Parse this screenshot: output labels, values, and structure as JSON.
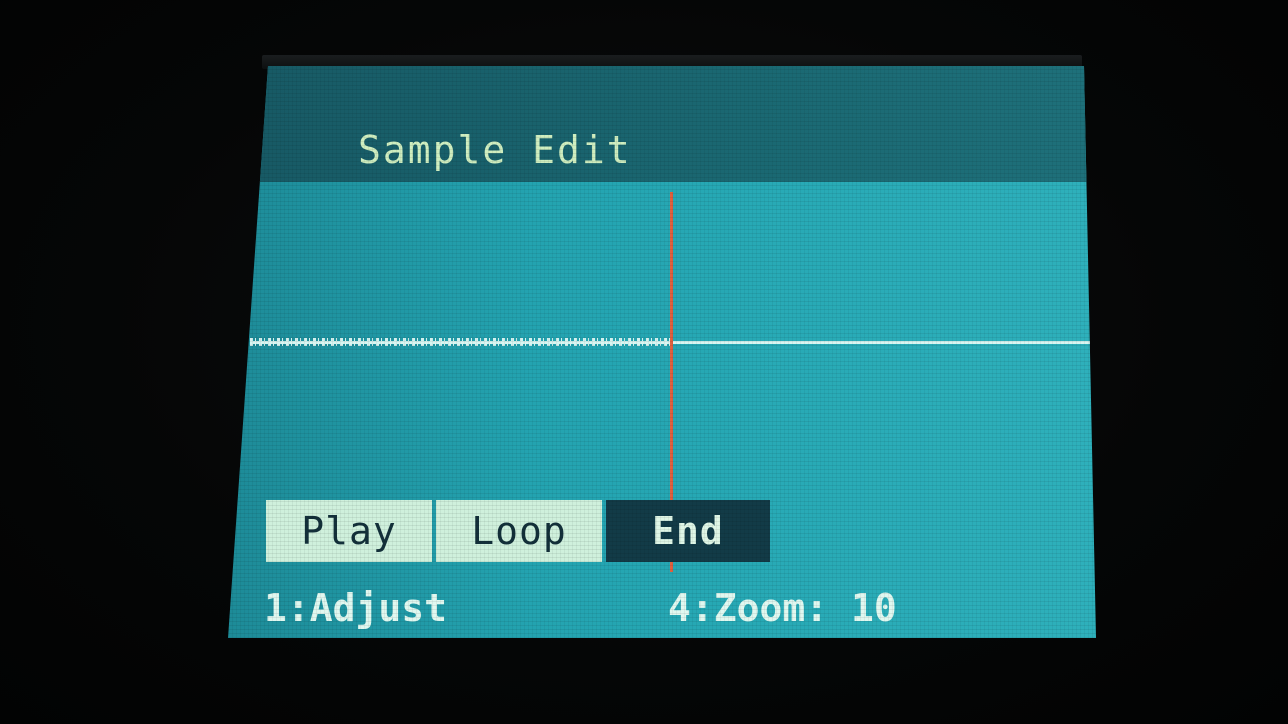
{
  "screen": {
    "title": "Sample Edit",
    "modes": [
      {
        "label": "Play",
        "selected": false
      },
      {
        "label": "Loop",
        "selected": false
      },
      {
        "label": "End",
        "selected": true
      }
    ],
    "knob_hints": {
      "knob1": "1:Adjust",
      "knob4": "4:Zoom: 10"
    },
    "zoom_level": 10
  },
  "colors": {
    "screen_background": "#27a9b5",
    "title_bar": "#1a6872",
    "marker": "#e0613e",
    "selected_tab": "#123b47",
    "inactive_tab": "#cff0dc"
  }
}
